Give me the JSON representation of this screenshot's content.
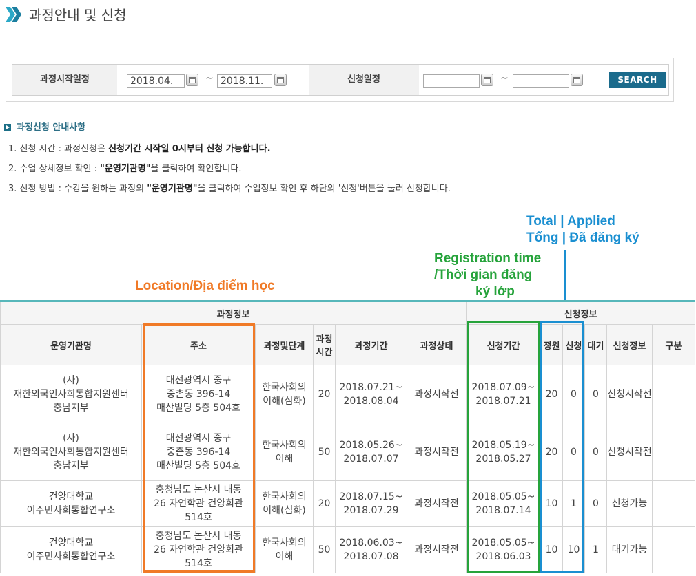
{
  "page": {
    "title": "과정안내 및 신청"
  },
  "search": {
    "start_label": "과정시작일정",
    "start_from": "2018.04.",
    "start_to": "2018.11.",
    "tilde": "~",
    "apply_label": "신청일정",
    "apply_from": "",
    "apply_to": "",
    "button": "SEARCH"
  },
  "notice": {
    "title": "과정신청 안내사항",
    "line1_a": "1. 신청 시간 : 과정신청은 ",
    "line1_b": "신청기간 시작일 0시부터 신청 가능합니다.",
    "line2_a": "2. 수업 상세정보 확인 : ",
    "line2_b": "\"운영기관명\"",
    "line2_c": "을 클릭하여 확인합니다.",
    "line3_a": "3. 신청 방법 : 수강을 원하는 과정의 ",
    "line3_b": "\"운영기관명\"",
    "line3_c": "을 클릭하여 수업정보 확인 후 하단의 '신청'버튼을 눌러 신청합니다."
  },
  "annotations": {
    "blue_1": "Total | Applied",
    "blue_2": "Tổng | Đã đăng ký",
    "green_1": "Registration time",
    "green_2": "/Thời gian đăng",
    "green_3": "ký lớp",
    "orange": "Location/Địa điểm học",
    "colors": {
      "blue": "#1a8fd1",
      "green": "#26a33b",
      "orange": "#f07a27"
    }
  },
  "table": {
    "group_course": "과정정보",
    "group_apply": "신청정보",
    "headers": {
      "org": "운영기관명",
      "addr": "주소",
      "level": "과정및단계",
      "hours_1": "과정",
      "hours_2": "시간",
      "period": "과정기간",
      "status": "과정상태",
      "apply_period": "신청기간",
      "cap": "정원",
      "applied": "신청",
      "wait": "대기",
      "apply_info": "신청정보",
      "kind": "구분"
    },
    "rows": [
      {
        "org_1": "(사)",
        "org_2": "재한외국인사회통합지원센터",
        "org_3": "충남지부",
        "addr_1": "대전광역시 중구",
        "addr_2": "중촌동 396-14",
        "addr_3": "매산빌딩 5층 504호",
        "level_1": "한국사회의",
        "level_2": "이해(심화)",
        "hours": "20",
        "period_1": "2018.07.21~",
        "period_2": "2018.08.04",
        "status": "과정시작전",
        "apply_1": "2018.07.09~",
        "apply_2": "2018.07.21",
        "cap": "20",
        "applied": "0",
        "wait": "0",
        "info": "신청시작전",
        "kind": ""
      },
      {
        "org_1": "(사)",
        "org_2": "재한외국인사회통합지원센터",
        "org_3": "충남지부",
        "addr_1": "대전광역시 중구",
        "addr_2": "중촌동 396-14",
        "addr_3": "매산빌딩 5층 504호",
        "level_1": "한국사회의",
        "level_2": "이해",
        "hours": "50",
        "period_1": "2018.05.26~",
        "period_2": "2018.07.07",
        "status": "과정시작전",
        "apply_1": "2018.05.19~",
        "apply_2": "2018.05.27",
        "cap": "20",
        "applied": "0",
        "wait": "0",
        "info": "신청시작전",
        "kind": ""
      },
      {
        "org_1": "건양대학교",
        "org_2": "이주민사회통합연구소",
        "org_3": "",
        "addr_1": "충청남도 논산시 내동",
        "addr_2": "26 자연학관 건양회관",
        "addr_3": "514호",
        "level_1": "한국사회의",
        "level_2": "이해(심화)",
        "hours": "20",
        "period_1": "2018.07.15~",
        "period_2": "2018.07.29",
        "status": "과정시작전",
        "apply_1": "2018.05.05~",
        "apply_2": "2018.07.14",
        "cap": "10",
        "applied": "1",
        "wait": "0",
        "info": "신청가능",
        "kind": ""
      },
      {
        "org_1": "건양대학교",
        "org_2": "이주민사회통합연구소",
        "org_3": "",
        "addr_1": "충청남도 논산시 내동",
        "addr_2": "26 자연학관 건양회관",
        "addr_3": "514호",
        "level_1": "한국사회의",
        "level_2": "이해",
        "hours": "50",
        "period_1": "2018.06.03~",
        "period_2": "2018.07.08",
        "status": "과정시작전",
        "apply_1": "2018.05.05~",
        "apply_2": "2018.06.03",
        "cap": "10",
        "applied": "10",
        "wait": "1",
        "info": "대기가능",
        "kind": ""
      }
    ]
  }
}
